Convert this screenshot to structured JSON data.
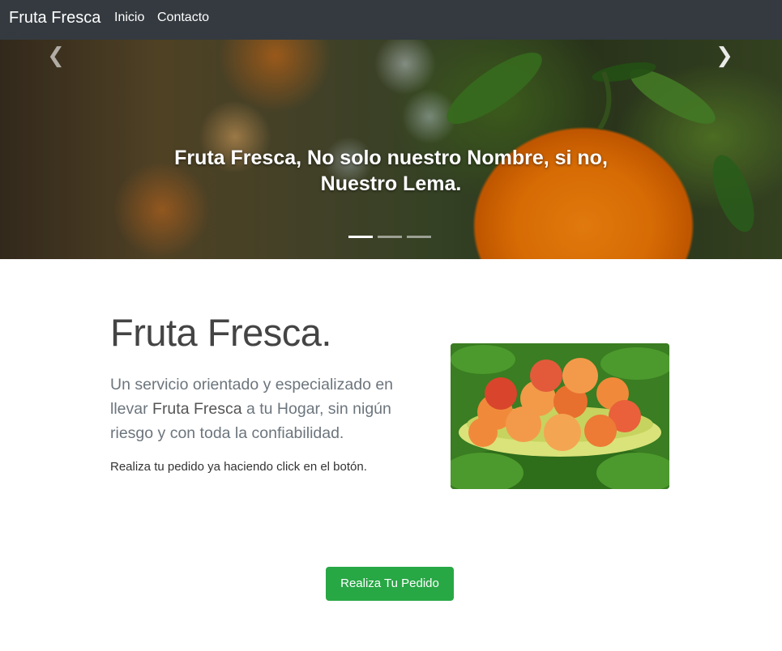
{
  "navbar": {
    "brand": "Fruta Fresca",
    "links": [
      {
        "label": "Inicio"
      },
      {
        "label": "Contacto"
      }
    ],
    "background": "#343a40"
  },
  "carousel": {
    "caption_line1": "Fruta Fresca, No solo nuestro Nombre, si no,",
    "caption_line2": "Nuestro Lema.",
    "prev_icon": "chevron-left-icon",
    "next_icon": "chevron-right-icon",
    "slide_count": 3,
    "active_slide": 1
  },
  "main": {
    "title": "Fruta Fresca.",
    "lead_part1": "Un servicio orientado y especializado en llevar ",
    "lead_strong": "Fruta Fresca",
    "lead_part2": " a tu Hogar, sin nigún riesgo y con toda la confiabilidad.",
    "small": "Realiza tu pedido ya haciendo click en el botón.",
    "image": "peaches-bowl-photo"
  },
  "cta": {
    "label": "Realiza Tu Pedido",
    "color": "#28a745"
  }
}
